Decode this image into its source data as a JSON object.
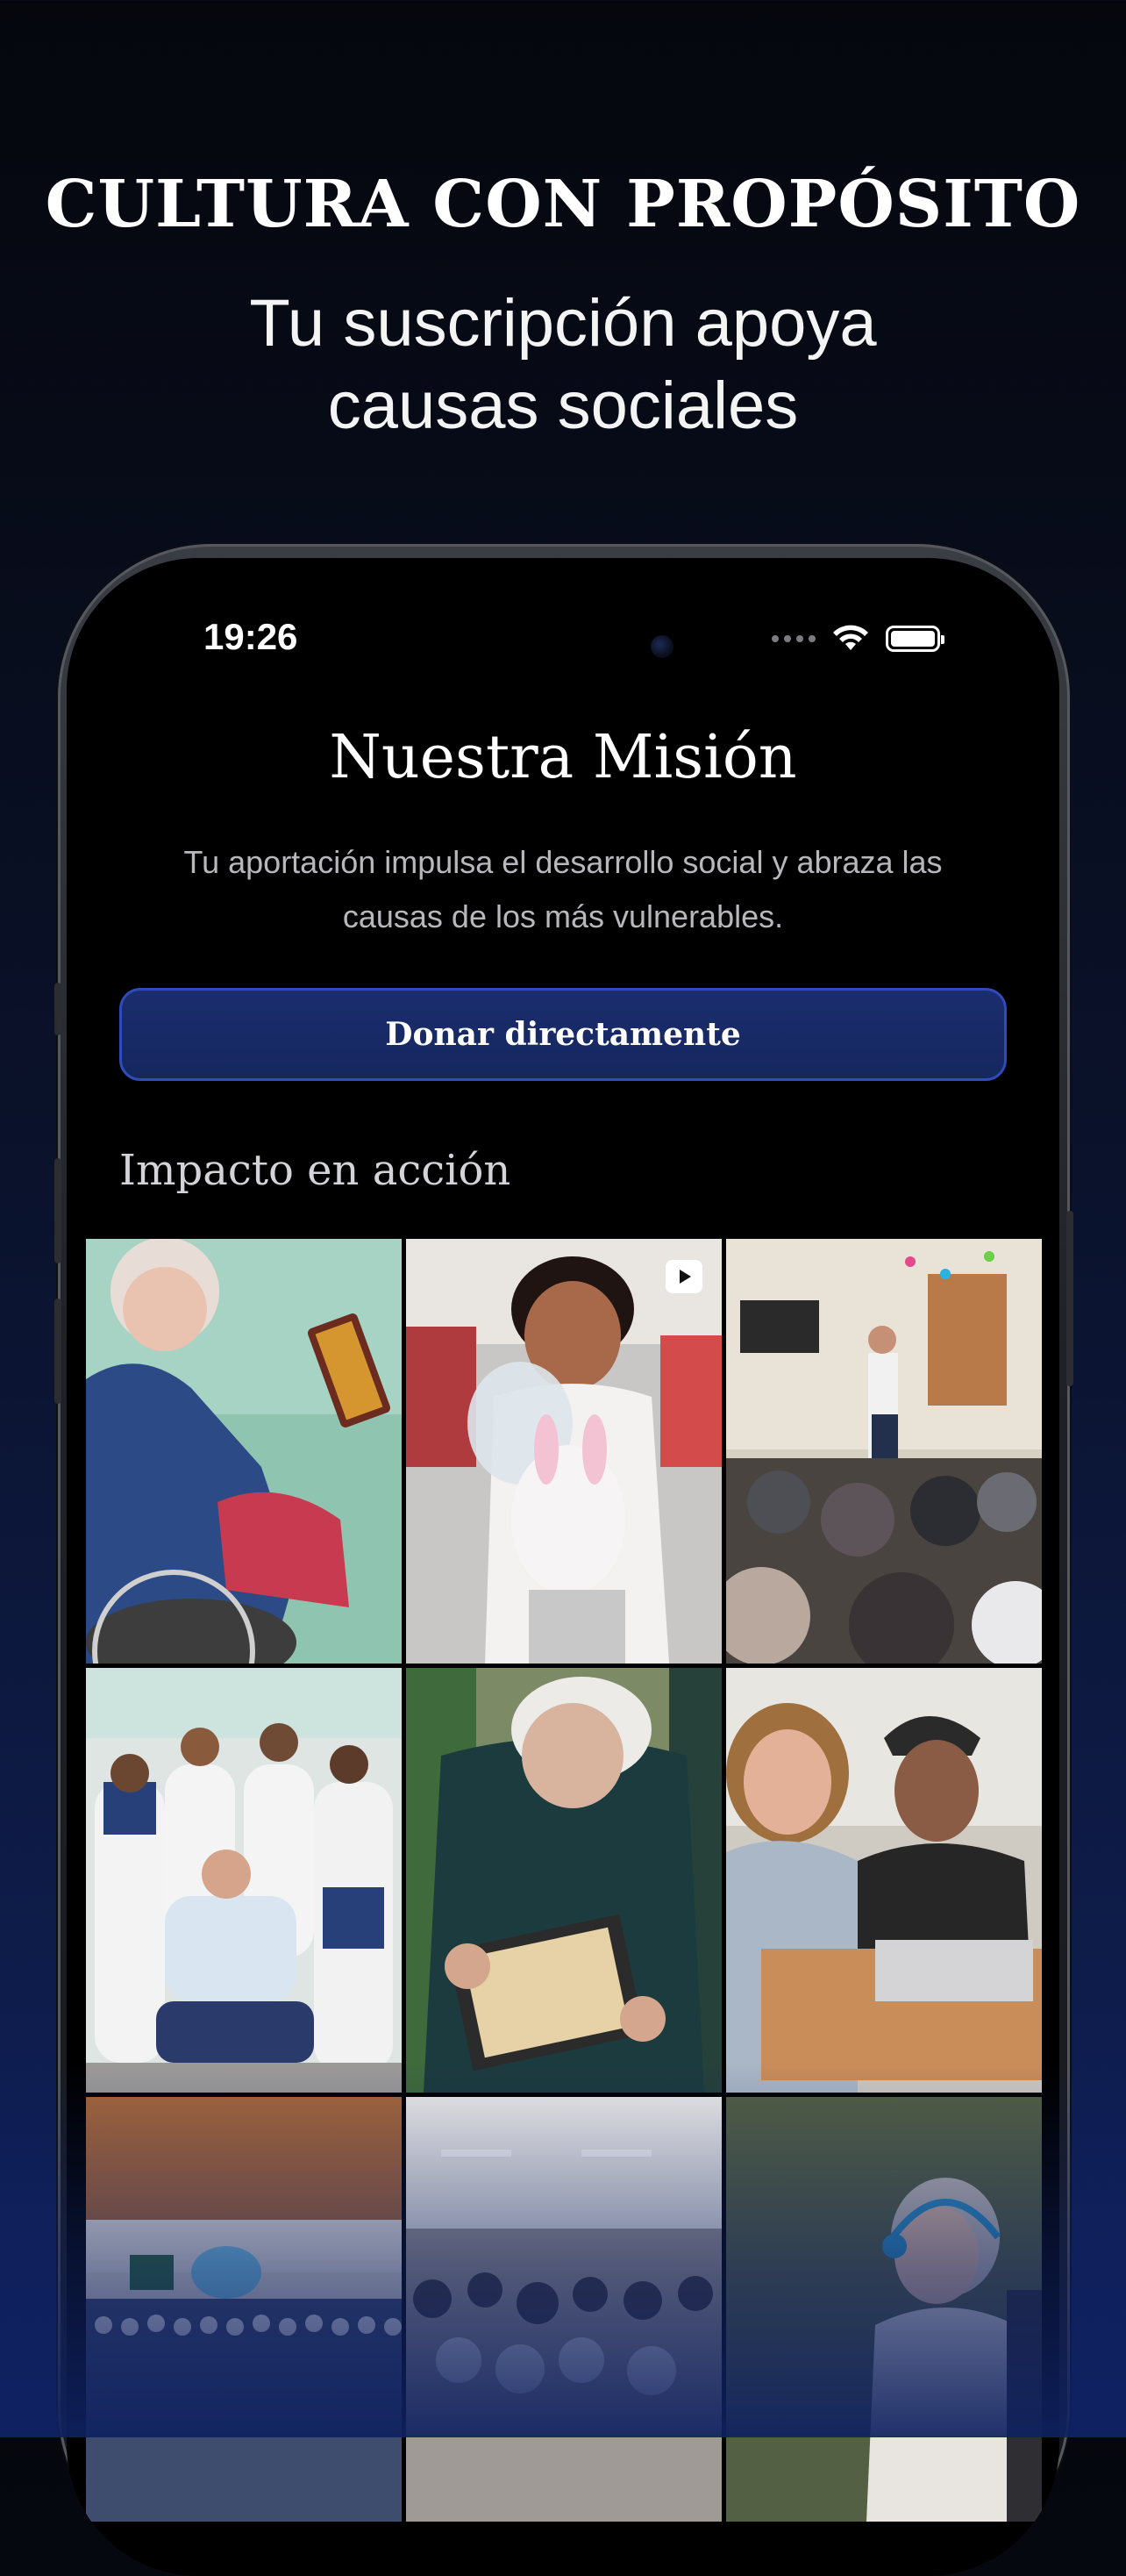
{
  "promo": {
    "headline": "CULTURA CON PROPÓSITO",
    "subline_1": "Tu suscripción apoya",
    "subline_2": "causas sociales"
  },
  "status_bar": {
    "time": "19:26",
    "icons": [
      "signal-dots-icon",
      "wifi-icon",
      "battery-icon"
    ]
  },
  "screen": {
    "title": "Nuestra Misión",
    "description": "Tu aportación impulsa el desarrollo social y abraza las causas de los más vulnerables.",
    "donate_button": "Donar directamente",
    "impact_heading": "Impacto en acción"
  },
  "gallery": {
    "photos": [
      {
        "subject": "elderly woman in wheelchair holding a box of chocolates",
        "is_video": false
      },
      {
        "subject": "girl holding a white plush bunny",
        "is_video": true
      },
      {
        "subject": "man presenting to seated audience",
        "is_video": false
      },
      {
        "subject": "group photo with nuns",
        "is_video": false
      },
      {
        "subject": "elderly woman holding a tray of chocolates",
        "is_video": false
      },
      {
        "subject": "two young men with eyeglasses donation",
        "is_video": false
      },
      {
        "subject": "children in a hall",
        "is_video": false
      },
      {
        "subject": "crowd of seniors in a room",
        "is_video": false
      },
      {
        "subject": "elderly woman with headphones",
        "is_video": false
      }
    ]
  },
  "colors": {
    "background_top": "#05070d",
    "background_bottom": "#0f2160",
    "button_fill": "#1a2d6e",
    "button_border": "#2e4cb8"
  }
}
